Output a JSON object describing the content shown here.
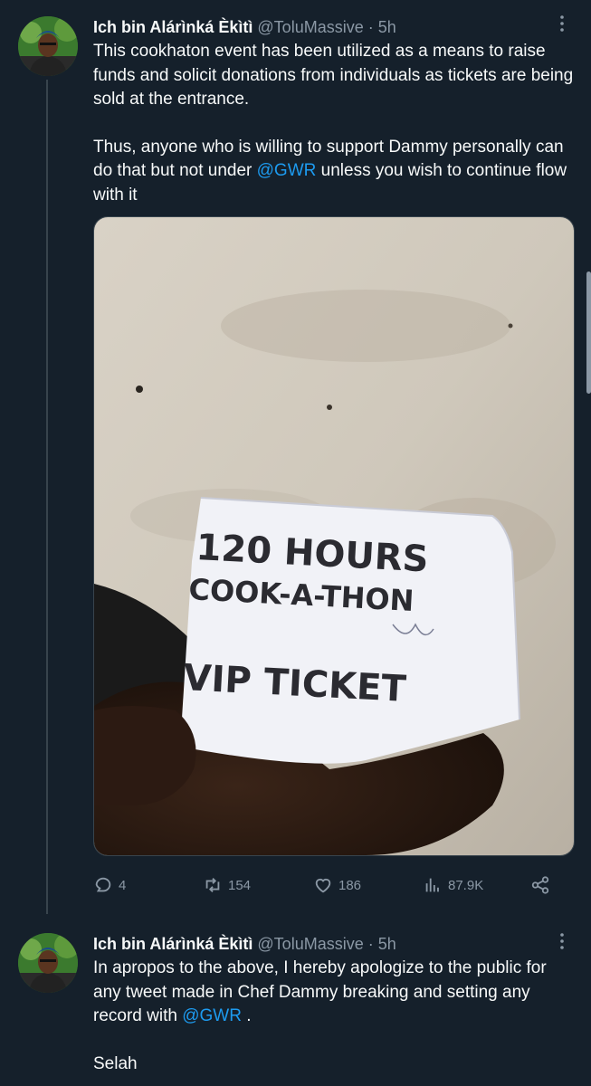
{
  "tweets": [
    {
      "author": {
        "name": "Ich bin Alárìnká Èkìtì",
        "handle": "@ToluMassive",
        "separator": "·",
        "time": "5h"
      },
      "paragraphs": [
        {
          "text": "This cookhaton event has been utilized as a means to raise funds and solicit donations from individuals as tickets are being sold at the entrance."
        },
        {
          "before": "Thus, anyone who is willing to support Dammy personally can do that but not under ",
          "mention": "@GWR",
          "after": " unless you wish to continue flow with it"
        }
      ],
      "media": {
        "ticket_line1": "120 HOURS",
        "ticket_line2": "COOK-A-THON",
        "ticket_line3": "VIP TICKET"
      },
      "actions": {
        "replies": "4",
        "reposts": "154",
        "likes": "186",
        "views": "87.9K"
      }
    },
    {
      "author": {
        "name": "Ich bin Alárìnká Èkìtì",
        "handle": "@ToluMassive",
        "separator": "·",
        "time": "5h"
      },
      "paragraphs": [
        {
          "before": "In apropos to the above, I hereby apologize to the public for any tweet made in Chef Dammy breaking and setting any record with ",
          "mention": "@GWR",
          "after": " ."
        },
        {
          "text": "Selah"
        }
      ]
    }
  ],
  "colors": {
    "background": "#15202b",
    "text": "#f7f9f9",
    "muted": "#8b98a5",
    "accent": "#1d9bf0"
  }
}
